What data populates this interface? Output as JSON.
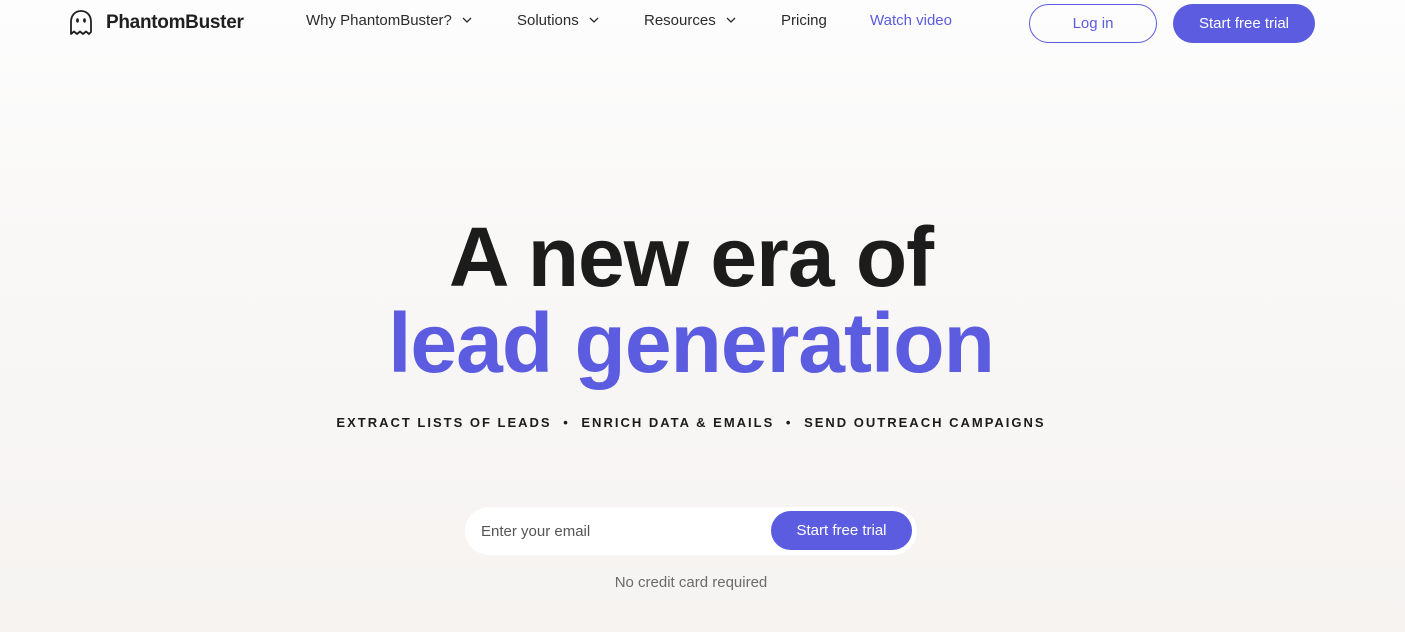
{
  "header": {
    "logo_text": "PhantomBuster",
    "logo_icon": "ghost-icon",
    "nav": {
      "why": "Why PhantomBuster?",
      "solutions": "Solutions",
      "resources": "Resources",
      "pricing": "Pricing",
      "watch_video": "Watch video"
    },
    "login_label": "Log in",
    "trial_label": "Start free trial"
  },
  "hero": {
    "headline_line1": "A new era of",
    "headline_line2": "lead generation",
    "tagline": {
      "item1": "EXTRACT LISTS OF LEADS",
      "item2": "ENRICH DATA & EMAILS",
      "item3": "SEND OUTREACH CAMPAIGNS",
      "separator": "•"
    }
  },
  "signup": {
    "email_placeholder": "Enter your email",
    "email_value": "",
    "button_label": "Start free trial",
    "note": "No credit card required"
  },
  "colors": {
    "accent": "#5b5ce0",
    "text": "#1c1c1c",
    "muted": "#6b6b6b",
    "background": "#f6f3f1"
  }
}
